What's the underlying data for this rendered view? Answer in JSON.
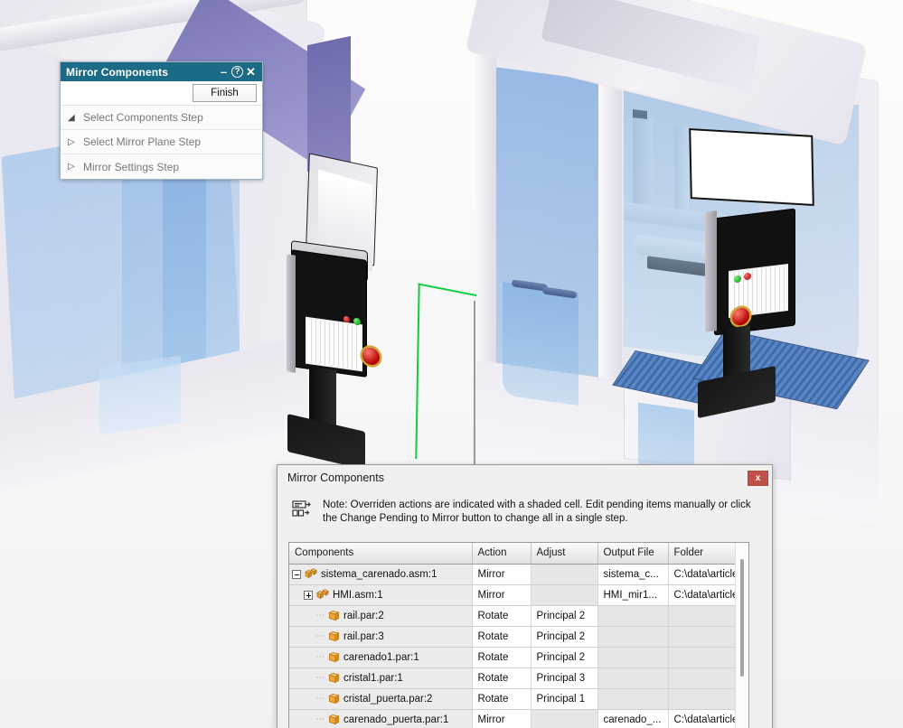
{
  "app": {
    "scene_description": "Solid Edge 3D assembly viewport with two machine enclosures and HMI panels"
  },
  "command_bar": {
    "title": "Mirror Components",
    "title_buttons": [
      {
        "name": "minimize",
        "glyph": "–"
      },
      {
        "name": "help",
        "glyph": "?"
      },
      {
        "name": "close",
        "glyph": "✕"
      }
    ],
    "finish_label": "Finish",
    "steps": [
      {
        "label": "Select Components Step",
        "arrow": "◢",
        "expanded": true
      },
      {
        "label": "Select Mirror Plane Step",
        "arrow": "▷",
        "expanded": false
      },
      {
        "label": "Mirror Settings Step",
        "arrow": "▷",
        "expanded": false
      }
    ]
  },
  "dialog": {
    "title": "Mirror Components",
    "close_label": "x",
    "note": "Note: Overriden actions are indicated with a shaded cell. Edit pending items manually or click the Change Pending to Mirror button to change all in a single step.",
    "note_icon": "change-pending-icon",
    "columns": [
      "Components",
      "Action",
      "Adjust",
      "Output File",
      "Folder"
    ],
    "rows": [
      {
        "name": "sistema_carenado.asm:1",
        "action": "Mirror",
        "adjust": "",
        "output_file": "sistema_c...",
        "folder": "C:\\data\\articles\\",
        "level": 0,
        "toggle": "minus",
        "icon": "assembly-icon",
        "action_shaded": false,
        "adjust_shaded": true,
        "output_shaded": false,
        "folder_shaded": false
      },
      {
        "name": "HMI.asm:1",
        "action": "Mirror",
        "adjust": "",
        "output_file": "HMI_mir1...",
        "folder": "C:\\data\\articles\\",
        "level": 1,
        "toggle": "plus",
        "icon": "assembly-icon",
        "action_shaded": false,
        "adjust_shaded": true,
        "output_shaded": false,
        "folder_shaded": false
      },
      {
        "name": "rail.par:2",
        "action": "Rotate",
        "adjust": "Principal 2",
        "output_file": "",
        "folder": "",
        "level": 2,
        "toggle": "none",
        "icon": "part-icon",
        "action_shaded": false,
        "adjust_shaded": false,
        "output_shaded": true,
        "folder_shaded": true
      },
      {
        "name": "rail.par:3",
        "action": "Rotate",
        "adjust": "Principal 2",
        "output_file": "",
        "folder": "",
        "level": 2,
        "toggle": "none",
        "icon": "part-icon",
        "action_shaded": false,
        "adjust_shaded": false,
        "output_shaded": true,
        "folder_shaded": true
      },
      {
        "name": "carenado1.par:1",
        "action": "Rotate",
        "adjust": "Principal 2",
        "output_file": "",
        "folder": "",
        "level": 2,
        "toggle": "none",
        "icon": "part-icon",
        "action_shaded": false,
        "adjust_shaded": false,
        "output_shaded": true,
        "folder_shaded": true
      },
      {
        "name": "cristal1.par:1",
        "action": "Rotate",
        "adjust": "Principal 3",
        "output_file": "",
        "folder": "",
        "level": 2,
        "toggle": "none",
        "icon": "part-icon",
        "action_shaded": false,
        "adjust_shaded": false,
        "output_shaded": true,
        "folder_shaded": true
      },
      {
        "name": "cristal_puerta.par:2",
        "action": "Rotate",
        "adjust": "Principal 1",
        "output_file": "",
        "folder": "",
        "level": 2,
        "toggle": "none",
        "icon": "part-icon",
        "action_shaded": false,
        "adjust_shaded": false,
        "output_shaded": true,
        "folder_shaded": true
      },
      {
        "name": "carenado_puerta.par:1",
        "action": "Mirror",
        "adjust": "",
        "output_file": "carenado_...",
        "folder": "C:\\data\\articles\\",
        "level": 2,
        "toggle": "none",
        "icon": "part-icon",
        "action_shaded": false,
        "adjust_shaded": true,
        "output_shaded": false,
        "folder_shaded": false
      }
    ],
    "scrollbar": {
      "name": "grid-vertical-scrollbar"
    }
  },
  "colors": {
    "titlebar": "#1b6a86",
    "close_button": "#c0504a",
    "mirror_plane": "#11cc3c",
    "assembly_icon": "#e8a33d",
    "part_icon": "#f0a63c"
  }
}
